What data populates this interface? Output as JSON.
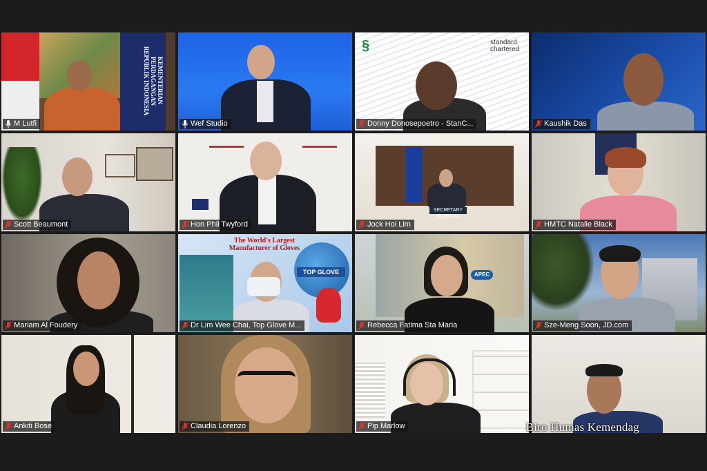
{
  "tiles": [
    {
      "name": "M Lutfi",
      "muted": false
    },
    {
      "name": "Wef Studio",
      "muted": false,
      "active": true
    },
    {
      "name": "Donny Donosepoetro - StanC...",
      "muted": true
    },
    {
      "name": "Kaushik Das",
      "muted": true
    },
    {
      "name": "Scott Beaumont",
      "muted": true
    },
    {
      "name": "Hon Phil Twyford",
      "muted": true
    },
    {
      "name": "Jock Hoi Lim",
      "muted": true
    },
    {
      "name": "HMTC Natalie Black",
      "muted": true
    },
    {
      "name": "Mariam Al Foudery",
      "muted": true
    },
    {
      "name": "Dr Lim Wee Chai, Top Glove M...",
      "muted": true
    },
    {
      "name": "Rebecca Fatima Sta Maria",
      "muted": true
    },
    {
      "name": "Sze-Meng Soon, JD.com",
      "muted": true
    },
    {
      "name": "Ankiti Bose",
      "muted": true
    },
    {
      "name": "Claudia Lorenzo",
      "muted": true
    },
    {
      "name": "Pip Marlow",
      "muted": true
    },
    {
      "name": "",
      "muted": false
    }
  ],
  "backgrounds": {
    "banner_vertical_text": "KEMENTERIAN PERDAGANGAN REPUBLIK INDONESIA",
    "standard_chartered": "standard chartered",
    "top_glove_headline": "The World's Largest Manufacturer of Gloves",
    "top_glove_brand": "TOP GLOVE",
    "secretary_general_plaque": "SECRETARY GENERAL",
    "apec_logo": "APEC"
  },
  "watermark": "Biro Humas Kemendag",
  "colors": {
    "active_speaker_border": "#d9e83a",
    "muted_icon": "#e0352b",
    "name_tag_bg": "#141414"
  }
}
